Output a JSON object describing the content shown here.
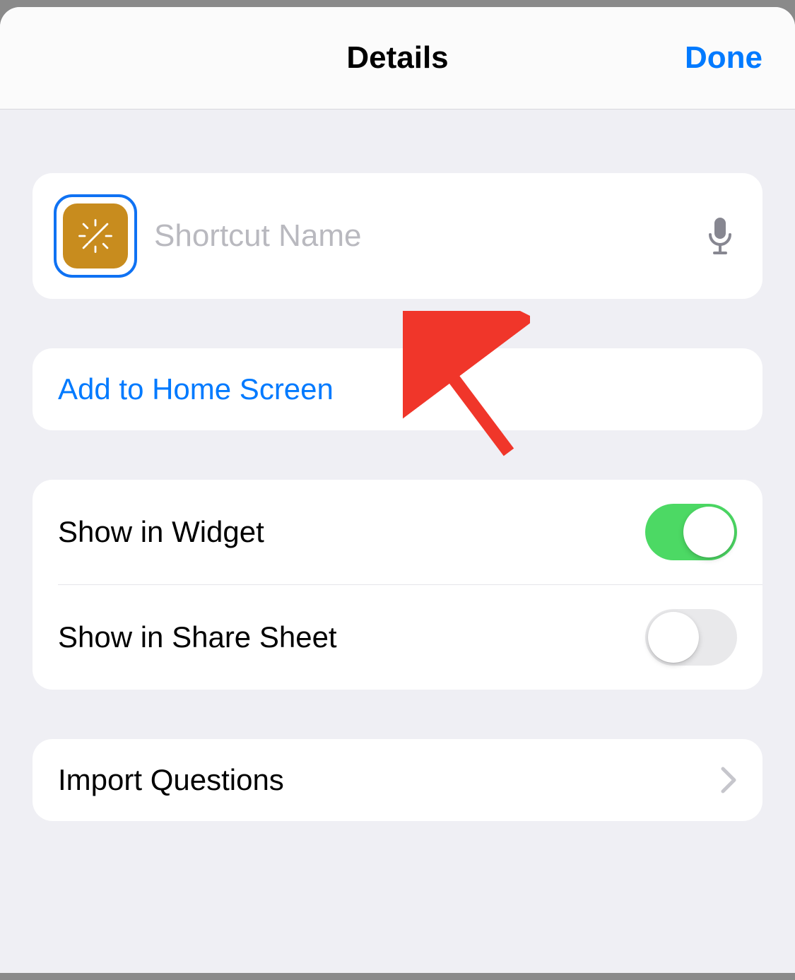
{
  "colors": {
    "accent": "#007aff",
    "iconTile": "#c88c1e",
    "toggleOn": "#4cd964",
    "toggleOff": "#e9e9eb",
    "annotationArrow": "#f0362a"
  },
  "nav": {
    "title": "Details",
    "done": "Done"
  },
  "shortcut": {
    "name_value": "",
    "name_placeholder": "Shortcut Name",
    "icon": "magic-wand-icon"
  },
  "actions": {
    "add_to_home_screen": "Add to Home Screen",
    "import_questions": "Import Questions"
  },
  "toggles": {
    "show_in_widget": {
      "label": "Show in Widget",
      "on": true
    },
    "show_in_share_sheet": {
      "label": "Show in Share Sheet",
      "on": false
    }
  }
}
